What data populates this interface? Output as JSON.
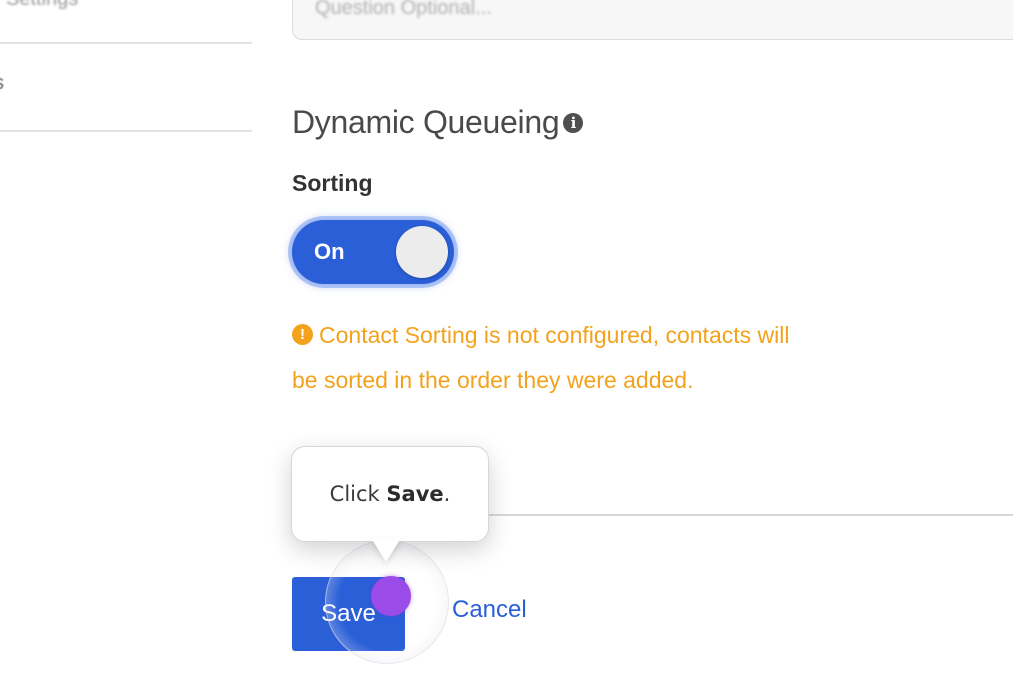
{
  "sidebar": {
    "items": [
      {
        "label": "Settings"
      },
      {
        "label": "s"
      }
    ]
  },
  "main": {
    "previous_input_placeholder": "Question Optional...",
    "section_title": "Dynamic Queueing",
    "info_icon": "info-circle-icon",
    "sorting_label": "Sorting",
    "toggle": {
      "label": "On",
      "state": "on"
    },
    "warning_text": "Contact Sorting is not configured, contacts will be sorted in the order they were added.",
    "warning_icon": "exclamation-circle-icon",
    "save_label": "Save",
    "cancel_label": "Cancel"
  },
  "tutorial": {
    "prefix": "Click",
    "emphasis": "Save",
    "suffix": "."
  },
  "colors": {
    "primary": "#2a5fd8",
    "warning": "#f2a21c",
    "cursor": "#9b4be8"
  }
}
